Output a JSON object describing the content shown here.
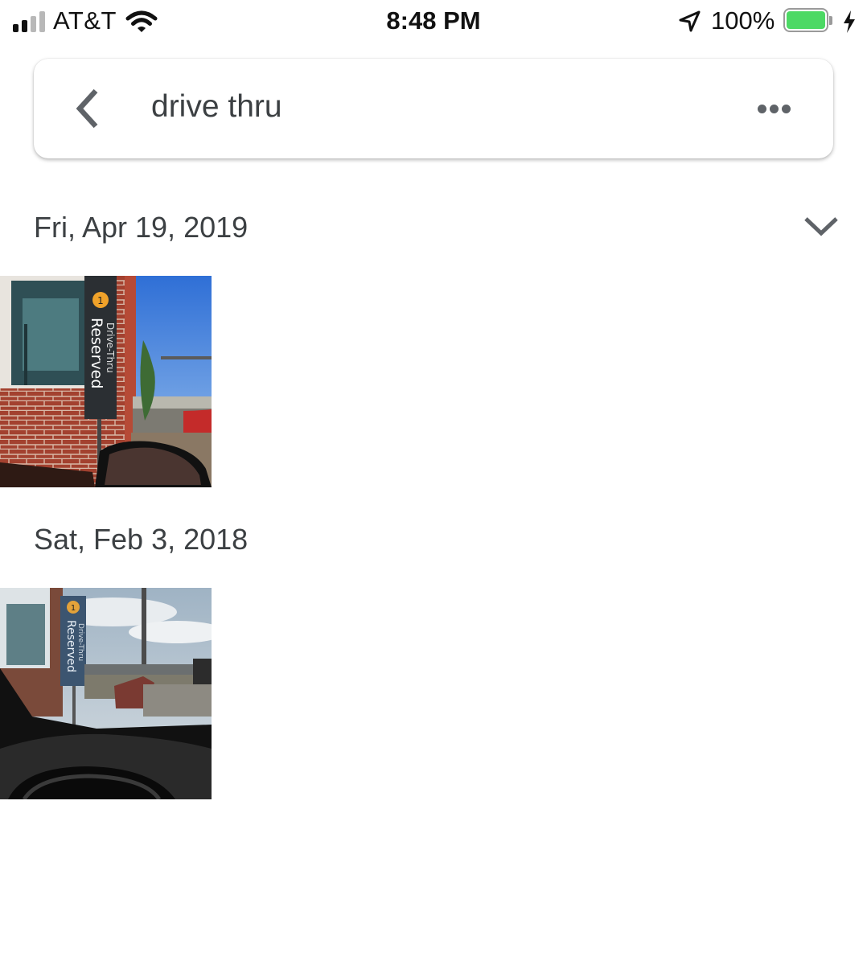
{
  "status_bar": {
    "carrier": "AT&T",
    "time": "8:48 PM",
    "battery_percent": "100%",
    "battery_level": 1.0,
    "signal_bars_filled": 2,
    "signal_bars_total": 4,
    "battery_color": "#4cd964",
    "icons": [
      "cellular-signal-icon",
      "wifi-icon",
      "location-arrow-icon",
      "battery-icon",
      "charging-bolt-icon"
    ]
  },
  "search": {
    "query": "drive thru",
    "icons": [
      "back-arrow-icon",
      "more-options-icon"
    ]
  },
  "sections": [
    {
      "date": "Fri, Apr 19, 2019",
      "photo_sign_text": "Reserved",
      "photo_sign_subtext": "Drive-Thru",
      "photo_sign_number": "1"
    },
    {
      "date": "Sat, Feb 3, 2018",
      "photo_sign_text": "Reserved",
      "photo_sign_subtext": "Drive-Thru",
      "photo_sign_number": "1"
    }
  ],
  "colors": {
    "text_primary": "#3c4043",
    "icon_grey": "#5f6368"
  }
}
